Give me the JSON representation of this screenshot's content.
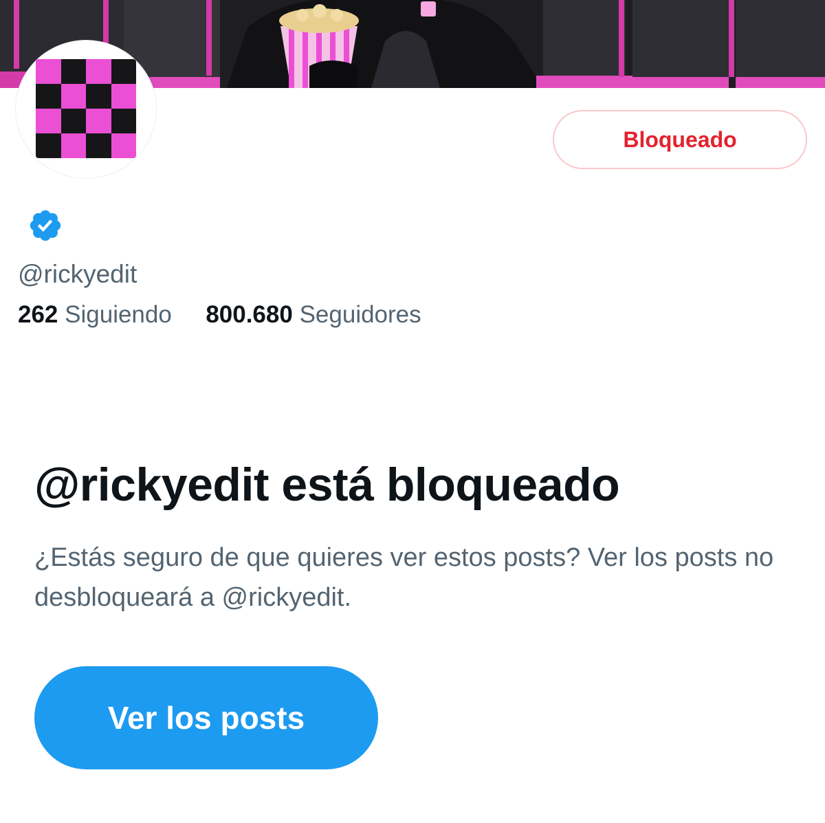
{
  "profile": {
    "handle": "@rickyedit",
    "verified_icon": "verified-badge-icon",
    "following_count": "262",
    "following_label": "Siguiendo",
    "followers_count": "800.680",
    "followers_label": "Seguidores"
  },
  "actions": {
    "blocked_label": "Bloqueado",
    "view_posts_label": "Ver los posts"
  },
  "blocked_notice": {
    "title": "@rickyedit está bloqueado",
    "description": "¿Estás seguro de que quieres ver estos posts? Ver los posts no desbloqueará a @rickyedit."
  },
  "colors": {
    "accent": "#1d9bf0",
    "blocked_text": "#e3222f",
    "blocked_border": "#f8c7cc",
    "secondary_text": "#536471",
    "avatar_pink": "#ea4fd4",
    "avatar_dark": "#161618"
  }
}
